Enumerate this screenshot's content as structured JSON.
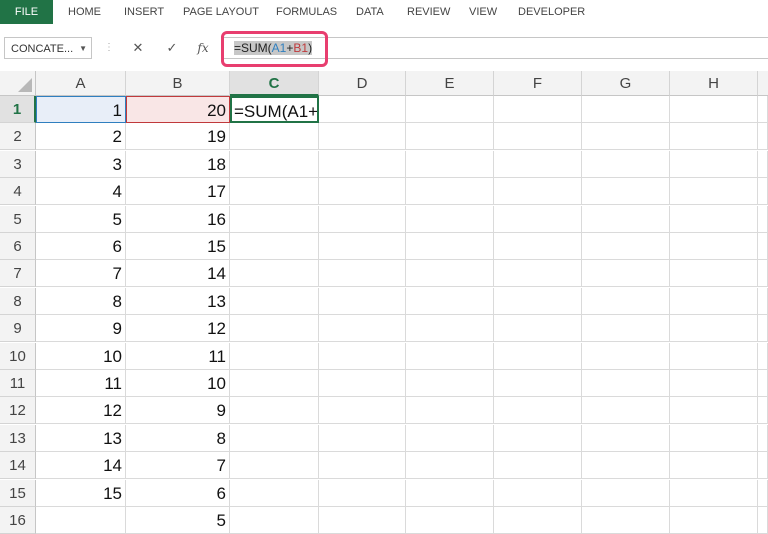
{
  "ribbon": {
    "file": "FILE",
    "tabs": [
      "HOME",
      "INSERT",
      "PAGE LAYOUT",
      "FORMULAS",
      "DATA",
      "REVIEW",
      "VIEW",
      "DEVELOPER"
    ]
  },
  "formula_bar": {
    "name_box": "CONCATE...",
    "cancel_symbol": "✕",
    "enter_symbol": "✓",
    "fx_symbol": "𝑓x",
    "formula_prefix": "=SUM(",
    "formula_ref_a": "A1",
    "formula_plus": "+",
    "formula_ref_b": "B1",
    "formula_suffix": ")"
  },
  "columns": [
    "A",
    "B",
    "C",
    "D",
    "E",
    "F",
    "G",
    "H"
  ],
  "active_column": "C",
  "active_row": "1",
  "rows": [
    {
      "num": "1",
      "a": "1",
      "b": "20"
    },
    {
      "num": "2",
      "a": "2",
      "b": "19"
    },
    {
      "num": "3",
      "a": "3",
      "b": "18"
    },
    {
      "num": "4",
      "a": "4",
      "b": "17"
    },
    {
      "num": "5",
      "a": "5",
      "b": "16"
    },
    {
      "num": "6",
      "a": "6",
      "b": "15"
    },
    {
      "num": "7",
      "a": "7",
      "b": "14"
    },
    {
      "num": "8",
      "a": "8",
      "b": "13"
    },
    {
      "num": "9",
      "a": "9",
      "b": "12"
    },
    {
      "num": "10",
      "a": "10",
      "b": "11"
    },
    {
      "num": "11",
      "a": "11",
      "b": "10"
    },
    {
      "num": "12",
      "a": "12",
      "b": "9"
    },
    {
      "num": "13",
      "a": "13",
      "b": "8"
    },
    {
      "num": "14",
      "a": "14",
      "b": "7"
    },
    {
      "num": "15",
      "a": "15",
      "b": "6"
    },
    {
      "num": "16",
      "a": "",
      "b": "5"
    }
  ],
  "editing_cell": {
    "ref": "C1",
    "text": "=SUM(A1+"
  },
  "colors": {
    "excel_green": "#217346",
    "ref_a_blue": "#2f7fbf",
    "ref_b_red": "#c0393b",
    "callout_pink": "#e83e6f"
  }
}
